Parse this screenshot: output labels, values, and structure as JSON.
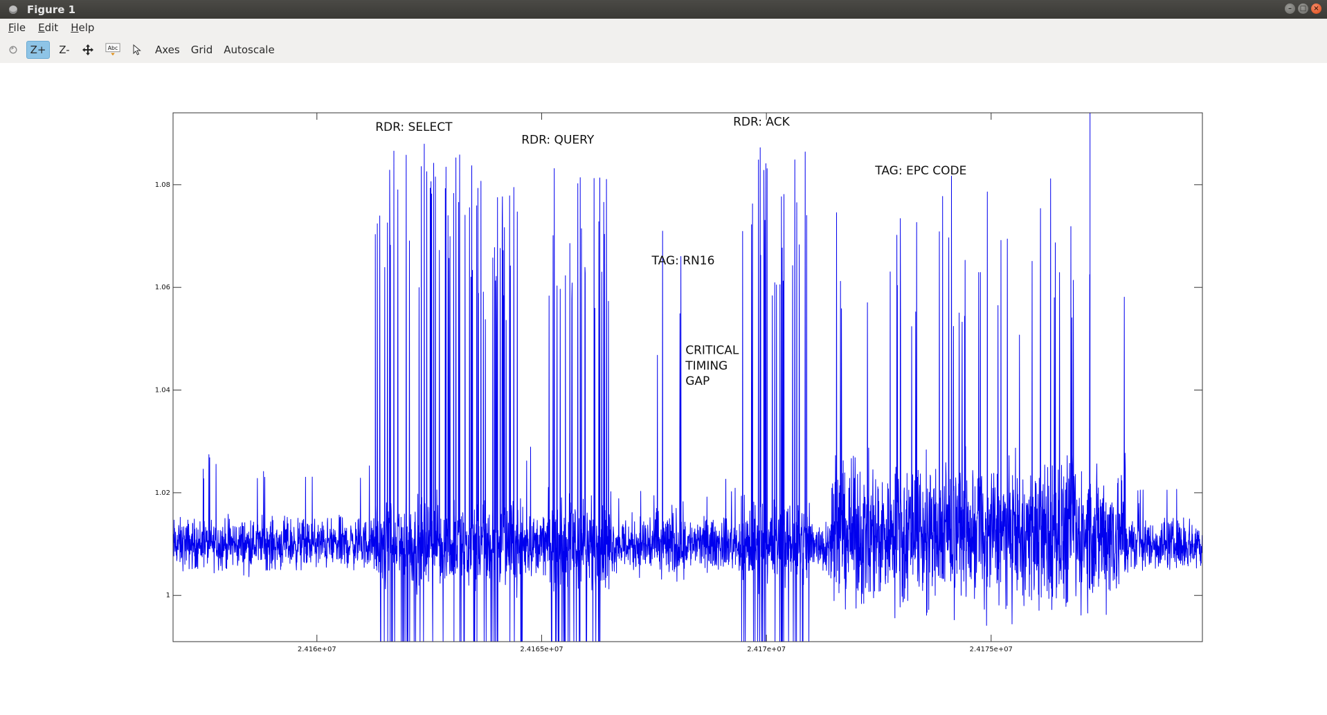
{
  "window": {
    "title": "Figure 1"
  },
  "menu": {
    "items": [
      "File",
      "Edit",
      "Help"
    ]
  },
  "toolbar": {
    "zoom_in_label": "Z+",
    "zoom_out_label": "Z-",
    "axes_label": "Axes",
    "grid_label": "Grid",
    "autoscale_label": "Autoscale",
    "text_tool_label": "Abc"
  },
  "colors": {
    "series": "#0000ee",
    "active_tool": "#8ec4e6"
  },
  "chart_data": {
    "type": "line",
    "title": "",
    "xlabel": "",
    "ylabel": "",
    "xlim": [
      24156800,
      24179700
    ],
    "ylim": [
      0.991,
      1.094
    ],
    "x_ticks": [
      24160000,
      24165000,
      24170000,
      24175000
    ],
    "x_tick_labels": [
      "2.416e+07",
      "2.4165e+07",
      "2.417e+07",
      "2.4175e+07"
    ],
    "y_ticks": [
      1.0,
      1.02,
      1.04,
      1.06,
      1.08
    ],
    "y_tick_labels": [
      "1",
      "1.02",
      "1.04",
      "1.06",
      "1.08"
    ],
    "grid": false,
    "series": [
      {
        "baseline": 1.01,
        "segments": [
          {
            "x_start": 24156800,
            "x_end": 24161300,
            "kind": "noise",
            "amplitude": 0.007,
            "peak": 1.028
          },
          {
            "x_start": 24161300,
            "x_end": 24163600,
            "kind": "burst",
            "high": 1.088,
            "low": 0.991,
            "label": "RDR: SELECT"
          },
          {
            "x_start": 24163600,
            "x_end": 24164600,
            "kind": "burst",
            "high": 1.082,
            "low": 0.991
          },
          {
            "x_start": 24164600,
            "x_end": 24165100,
            "kind": "noise",
            "amplitude": 0.008,
            "peak": 1.029
          },
          {
            "x_start": 24165100,
            "x_end": 24166500,
            "kind": "burst",
            "high": 1.085,
            "low": 0.991,
            "label": "RDR: QUERY"
          },
          {
            "x_start": 24166500,
            "x_end": 24167300,
            "kind": "noise",
            "amplitude": 0.008,
            "peak": 1.022
          },
          {
            "x_start": 24167300,
            "x_end": 24168200,
            "kind": "spikes",
            "high": 1.08,
            "low": 1.004,
            "label": "TAG: RN16"
          },
          {
            "x_start": 24168200,
            "x_end": 24169400,
            "kind": "noise",
            "amplitude": 0.007,
            "peak": 1.023,
            "label": "CRITICAL TIMING GAP"
          },
          {
            "x_start": 24169400,
            "x_end": 24171000,
            "kind": "burst",
            "high": 1.088,
            "low": 0.991,
            "label": "RDR: ACK"
          },
          {
            "x_start": 24171000,
            "x_end": 24171500,
            "kind": "noise",
            "amplitude": 0.008,
            "peak": 1.024
          },
          {
            "x_start": 24171500,
            "x_end": 24178000,
            "kind": "tag",
            "high": 1.094,
            "low": 0.995,
            "label": "TAG: EPC CODE"
          },
          {
            "x_start": 24178000,
            "x_end": 24179700,
            "kind": "noise",
            "amplitude": 0.007,
            "peak": 1.021
          }
        ]
      }
    ],
    "annotations": [
      {
        "text": "RDR: SELECT",
        "x": 24161300,
        "y": 1.0905
      },
      {
        "text": "RDR: QUERY",
        "x": 24164550,
        "y": 1.088
      },
      {
        "text": "TAG: RN16",
        "x": 24167450,
        "y": 1.0645
      },
      {
        "text": "CRITICAL",
        "x": 24168200,
        "y": 1.047
      },
      {
        "text": "TIMING",
        "x": 24168200,
        "y": 1.044
      },
      {
        "text": "GAP",
        "x": 24168200,
        "y": 1.041
      },
      {
        "text": "RDR: ACK",
        "x": 24169260,
        "y": 1.0915
      },
      {
        "text": "TAG: EPC CODE",
        "x": 24172420,
        "y": 1.082
      }
    ]
  }
}
